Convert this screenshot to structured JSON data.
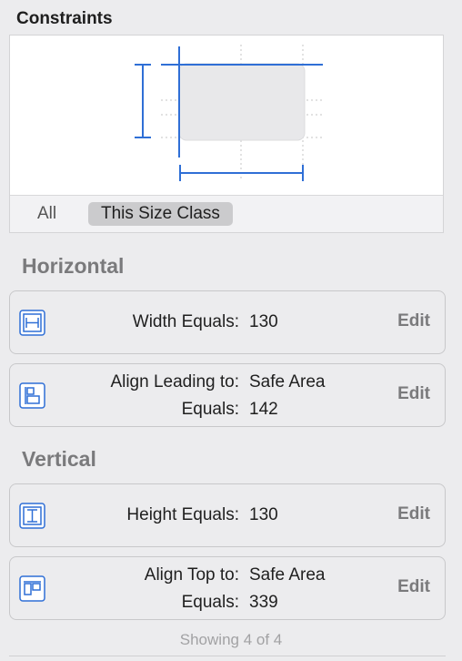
{
  "panel": {
    "title": "Constraints"
  },
  "size_class_tabs": [
    {
      "label": "All",
      "selected": false
    },
    {
      "label": "This Size Class",
      "selected": true
    }
  ],
  "sections": {
    "horizontal": {
      "title": "Horizontal",
      "constraints": [
        {
          "icon": "width-constraint-icon",
          "label": "Width Equals:",
          "value": "130",
          "action": "Edit"
        },
        {
          "icon": "align-leading-icon",
          "label": "Align Leading to:",
          "value": "Safe Area",
          "label2": "Equals:",
          "value2": "142",
          "action": "Edit"
        }
      ]
    },
    "vertical": {
      "title": "Vertical",
      "constraints": [
        {
          "icon": "height-constraint-icon",
          "label": "Height Equals:",
          "value": "130",
          "action": "Edit"
        },
        {
          "icon": "align-top-icon",
          "label": "Align Top to:",
          "value": "Safe Area",
          "label2": "Equals:",
          "value2": "339",
          "action": "Edit"
        }
      ]
    }
  },
  "footer": {
    "text": "Showing 4 of 4"
  },
  "colors": {
    "accent": "#2f6fd6",
    "background": "#ececee"
  }
}
